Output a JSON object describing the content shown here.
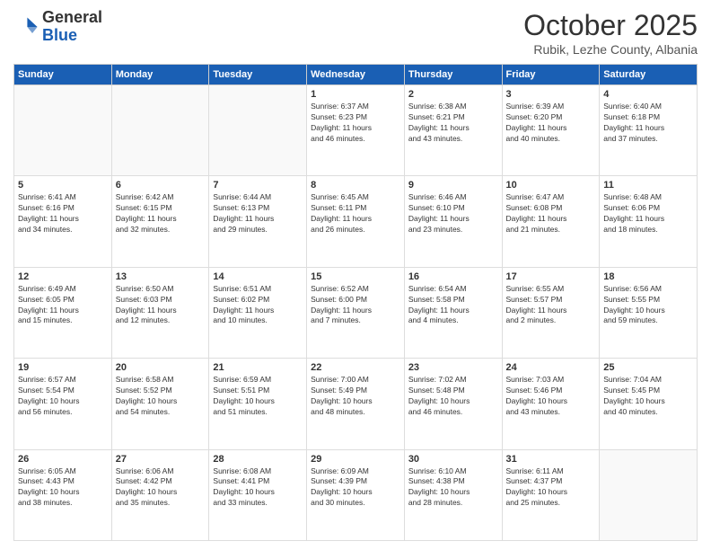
{
  "header": {
    "logo_general": "General",
    "logo_blue": "Blue",
    "month_title": "October 2025",
    "location": "Rubik, Lezhe County, Albania"
  },
  "days_of_week": [
    "Sunday",
    "Monday",
    "Tuesday",
    "Wednesday",
    "Thursday",
    "Friday",
    "Saturday"
  ],
  "weeks": [
    [
      {
        "day": "",
        "info": ""
      },
      {
        "day": "",
        "info": ""
      },
      {
        "day": "",
        "info": ""
      },
      {
        "day": "1",
        "info": "Sunrise: 6:37 AM\nSunset: 6:23 PM\nDaylight: 11 hours\nand 46 minutes."
      },
      {
        "day": "2",
        "info": "Sunrise: 6:38 AM\nSunset: 6:21 PM\nDaylight: 11 hours\nand 43 minutes."
      },
      {
        "day": "3",
        "info": "Sunrise: 6:39 AM\nSunset: 6:20 PM\nDaylight: 11 hours\nand 40 minutes."
      },
      {
        "day": "4",
        "info": "Sunrise: 6:40 AM\nSunset: 6:18 PM\nDaylight: 11 hours\nand 37 minutes."
      }
    ],
    [
      {
        "day": "5",
        "info": "Sunrise: 6:41 AM\nSunset: 6:16 PM\nDaylight: 11 hours\nand 34 minutes."
      },
      {
        "day": "6",
        "info": "Sunrise: 6:42 AM\nSunset: 6:15 PM\nDaylight: 11 hours\nand 32 minutes."
      },
      {
        "day": "7",
        "info": "Sunrise: 6:44 AM\nSunset: 6:13 PM\nDaylight: 11 hours\nand 29 minutes."
      },
      {
        "day": "8",
        "info": "Sunrise: 6:45 AM\nSunset: 6:11 PM\nDaylight: 11 hours\nand 26 minutes."
      },
      {
        "day": "9",
        "info": "Sunrise: 6:46 AM\nSunset: 6:10 PM\nDaylight: 11 hours\nand 23 minutes."
      },
      {
        "day": "10",
        "info": "Sunrise: 6:47 AM\nSunset: 6:08 PM\nDaylight: 11 hours\nand 21 minutes."
      },
      {
        "day": "11",
        "info": "Sunrise: 6:48 AM\nSunset: 6:06 PM\nDaylight: 11 hours\nand 18 minutes."
      }
    ],
    [
      {
        "day": "12",
        "info": "Sunrise: 6:49 AM\nSunset: 6:05 PM\nDaylight: 11 hours\nand 15 minutes."
      },
      {
        "day": "13",
        "info": "Sunrise: 6:50 AM\nSunset: 6:03 PM\nDaylight: 11 hours\nand 12 minutes."
      },
      {
        "day": "14",
        "info": "Sunrise: 6:51 AM\nSunset: 6:02 PM\nDaylight: 11 hours\nand 10 minutes."
      },
      {
        "day": "15",
        "info": "Sunrise: 6:52 AM\nSunset: 6:00 PM\nDaylight: 11 hours\nand 7 minutes."
      },
      {
        "day": "16",
        "info": "Sunrise: 6:54 AM\nSunset: 5:58 PM\nDaylight: 11 hours\nand 4 minutes."
      },
      {
        "day": "17",
        "info": "Sunrise: 6:55 AM\nSunset: 5:57 PM\nDaylight: 11 hours\nand 2 minutes."
      },
      {
        "day": "18",
        "info": "Sunrise: 6:56 AM\nSunset: 5:55 PM\nDaylight: 10 hours\nand 59 minutes."
      }
    ],
    [
      {
        "day": "19",
        "info": "Sunrise: 6:57 AM\nSunset: 5:54 PM\nDaylight: 10 hours\nand 56 minutes."
      },
      {
        "day": "20",
        "info": "Sunrise: 6:58 AM\nSunset: 5:52 PM\nDaylight: 10 hours\nand 54 minutes."
      },
      {
        "day": "21",
        "info": "Sunrise: 6:59 AM\nSunset: 5:51 PM\nDaylight: 10 hours\nand 51 minutes."
      },
      {
        "day": "22",
        "info": "Sunrise: 7:00 AM\nSunset: 5:49 PM\nDaylight: 10 hours\nand 48 minutes."
      },
      {
        "day": "23",
        "info": "Sunrise: 7:02 AM\nSunset: 5:48 PM\nDaylight: 10 hours\nand 46 minutes."
      },
      {
        "day": "24",
        "info": "Sunrise: 7:03 AM\nSunset: 5:46 PM\nDaylight: 10 hours\nand 43 minutes."
      },
      {
        "day": "25",
        "info": "Sunrise: 7:04 AM\nSunset: 5:45 PM\nDaylight: 10 hours\nand 40 minutes."
      }
    ],
    [
      {
        "day": "26",
        "info": "Sunrise: 6:05 AM\nSunset: 4:43 PM\nDaylight: 10 hours\nand 38 minutes."
      },
      {
        "day": "27",
        "info": "Sunrise: 6:06 AM\nSunset: 4:42 PM\nDaylight: 10 hours\nand 35 minutes."
      },
      {
        "day": "28",
        "info": "Sunrise: 6:08 AM\nSunset: 4:41 PM\nDaylight: 10 hours\nand 33 minutes."
      },
      {
        "day": "29",
        "info": "Sunrise: 6:09 AM\nSunset: 4:39 PM\nDaylight: 10 hours\nand 30 minutes."
      },
      {
        "day": "30",
        "info": "Sunrise: 6:10 AM\nSunset: 4:38 PM\nDaylight: 10 hours\nand 28 minutes."
      },
      {
        "day": "31",
        "info": "Sunrise: 6:11 AM\nSunset: 4:37 PM\nDaylight: 10 hours\nand 25 minutes."
      },
      {
        "day": "",
        "info": ""
      }
    ]
  ]
}
